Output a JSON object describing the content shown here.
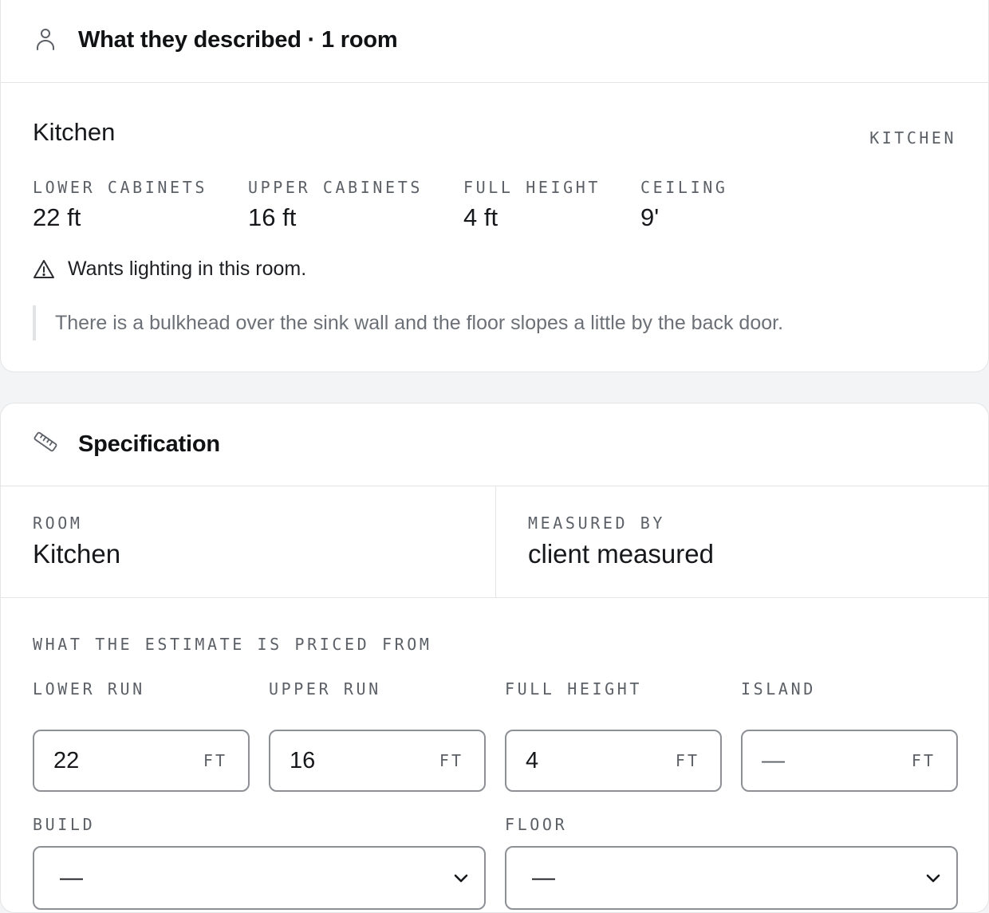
{
  "described": {
    "title": "What they described · 1 room",
    "room": {
      "name": "Kitchen",
      "tag": "KITCHEN",
      "metrics": [
        {
          "label": "LOWER CABINETS",
          "value": "22 ft"
        },
        {
          "label": "UPPER CABINETS",
          "value": "16 ft"
        },
        {
          "label": "FULL HEIGHT",
          "value": "4 ft"
        },
        {
          "label": "CEILING",
          "value": "9'"
        }
      ],
      "notice": "Wants lighting in this room.",
      "note": "There is a bulkhead over the sink wall and the floor slopes a little by the back door."
    }
  },
  "spec": {
    "title": "Specification",
    "room_label": "ROOM",
    "room_value": "Kitchen",
    "measured_label": "MEASURED BY",
    "measured_value": "client measured",
    "priced_from_label": "WHAT THE ESTIMATE IS PRICED FROM",
    "fields": [
      {
        "label": "LOWER RUN",
        "value": "22",
        "placeholder": "",
        "unit": "FT"
      },
      {
        "label": "UPPER RUN",
        "value": "16",
        "placeholder": "",
        "unit": "FT"
      },
      {
        "label": "FULL HEIGHT",
        "value": "4",
        "placeholder": "",
        "unit": "FT"
      },
      {
        "label": "ISLAND",
        "value": "",
        "placeholder": "—",
        "unit": "FT"
      }
    ],
    "build_label": "BUILD",
    "build_value": "—",
    "floor_label": "FLOOR",
    "floor_value": "—"
  },
  "icons": {
    "described": "person-icon",
    "notice": "warning-triangle-icon",
    "spec": "ruler-icon",
    "select": "chevron-down-icon"
  }
}
